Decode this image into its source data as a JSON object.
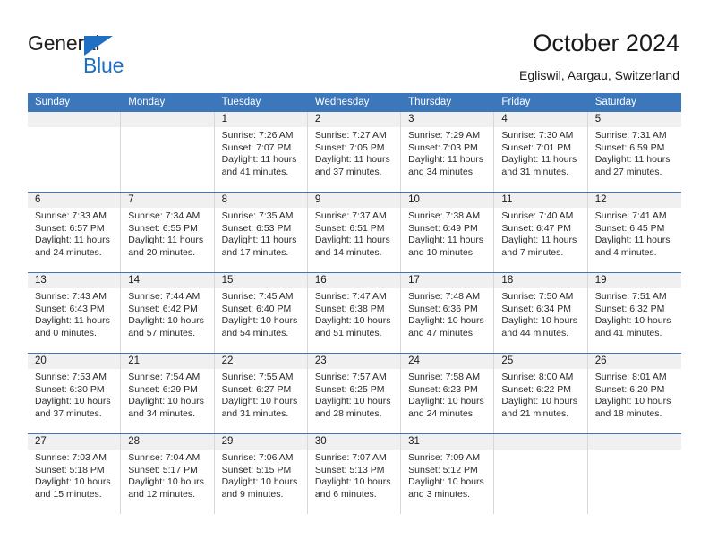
{
  "brand": {
    "name_top": "General",
    "name_bottom": "Blue",
    "flag_color": "#1f6fc4"
  },
  "header": {
    "title": "October 2024",
    "subtitle": "Egliswil, Aargau, Switzerland"
  },
  "theme": {
    "header_blue": "#3c77bc",
    "daynum_band": "#f0f0f0",
    "grid_line": "#d8d8d8"
  },
  "calendar": {
    "weekday_headers": [
      "Sunday",
      "Monday",
      "Tuesday",
      "Wednesday",
      "Thursday",
      "Friday",
      "Saturday"
    ],
    "weeks": [
      [
        {
          "day": "",
          "sunrise": "",
          "sunset": "",
          "daylight_line1": "",
          "daylight_line2": ""
        },
        {
          "day": "",
          "sunrise": "",
          "sunset": "",
          "daylight_line1": "",
          "daylight_line2": ""
        },
        {
          "day": "1",
          "sunrise": "Sunrise: 7:26 AM",
          "sunset": "Sunset: 7:07 PM",
          "daylight_line1": "Daylight: 11 hours",
          "daylight_line2": "and 41 minutes."
        },
        {
          "day": "2",
          "sunrise": "Sunrise: 7:27 AM",
          "sunset": "Sunset: 7:05 PM",
          "daylight_line1": "Daylight: 11 hours",
          "daylight_line2": "and 37 minutes."
        },
        {
          "day": "3",
          "sunrise": "Sunrise: 7:29 AM",
          "sunset": "Sunset: 7:03 PM",
          "daylight_line1": "Daylight: 11 hours",
          "daylight_line2": "and 34 minutes."
        },
        {
          "day": "4",
          "sunrise": "Sunrise: 7:30 AM",
          "sunset": "Sunset: 7:01 PM",
          "daylight_line1": "Daylight: 11 hours",
          "daylight_line2": "and 31 minutes."
        },
        {
          "day": "5",
          "sunrise": "Sunrise: 7:31 AM",
          "sunset": "Sunset: 6:59 PM",
          "daylight_line1": "Daylight: 11 hours",
          "daylight_line2": "and 27 minutes."
        }
      ],
      [
        {
          "day": "6",
          "sunrise": "Sunrise: 7:33 AM",
          "sunset": "Sunset: 6:57 PM",
          "daylight_line1": "Daylight: 11 hours",
          "daylight_line2": "and 24 minutes."
        },
        {
          "day": "7",
          "sunrise": "Sunrise: 7:34 AM",
          "sunset": "Sunset: 6:55 PM",
          "daylight_line1": "Daylight: 11 hours",
          "daylight_line2": "and 20 minutes."
        },
        {
          "day": "8",
          "sunrise": "Sunrise: 7:35 AM",
          "sunset": "Sunset: 6:53 PM",
          "daylight_line1": "Daylight: 11 hours",
          "daylight_line2": "and 17 minutes."
        },
        {
          "day": "9",
          "sunrise": "Sunrise: 7:37 AM",
          "sunset": "Sunset: 6:51 PM",
          "daylight_line1": "Daylight: 11 hours",
          "daylight_line2": "and 14 minutes."
        },
        {
          "day": "10",
          "sunrise": "Sunrise: 7:38 AM",
          "sunset": "Sunset: 6:49 PM",
          "daylight_line1": "Daylight: 11 hours",
          "daylight_line2": "and 10 minutes."
        },
        {
          "day": "11",
          "sunrise": "Sunrise: 7:40 AM",
          "sunset": "Sunset: 6:47 PM",
          "daylight_line1": "Daylight: 11 hours",
          "daylight_line2": "and 7 minutes."
        },
        {
          "day": "12",
          "sunrise": "Sunrise: 7:41 AM",
          "sunset": "Sunset: 6:45 PM",
          "daylight_line1": "Daylight: 11 hours",
          "daylight_line2": "and 4 minutes."
        }
      ],
      [
        {
          "day": "13",
          "sunrise": "Sunrise: 7:43 AM",
          "sunset": "Sunset: 6:43 PM",
          "daylight_line1": "Daylight: 11 hours",
          "daylight_line2": "and 0 minutes."
        },
        {
          "day": "14",
          "sunrise": "Sunrise: 7:44 AM",
          "sunset": "Sunset: 6:42 PM",
          "daylight_line1": "Daylight: 10 hours",
          "daylight_line2": "and 57 minutes."
        },
        {
          "day": "15",
          "sunrise": "Sunrise: 7:45 AM",
          "sunset": "Sunset: 6:40 PM",
          "daylight_line1": "Daylight: 10 hours",
          "daylight_line2": "and 54 minutes."
        },
        {
          "day": "16",
          "sunrise": "Sunrise: 7:47 AM",
          "sunset": "Sunset: 6:38 PM",
          "daylight_line1": "Daylight: 10 hours",
          "daylight_line2": "and 51 minutes."
        },
        {
          "day": "17",
          "sunrise": "Sunrise: 7:48 AM",
          "sunset": "Sunset: 6:36 PM",
          "daylight_line1": "Daylight: 10 hours",
          "daylight_line2": "and 47 minutes."
        },
        {
          "day": "18",
          "sunrise": "Sunrise: 7:50 AM",
          "sunset": "Sunset: 6:34 PM",
          "daylight_line1": "Daylight: 10 hours",
          "daylight_line2": "and 44 minutes."
        },
        {
          "day": "19",
          "sunrise": "Sunrise: 7:51 AM",
          "sunset": "Sunset: 6:32 PM",
          "daylight_line1": "Daylight: 10 hours",
          "daylight_line2": "and 41 minutes."
        }
      ],
      [
        {
          "day": "20",
          "sunrise": "Sunrise: 7:53 AM",
          "sunset": "Sunset: 6:30 PM",
          "daylight_line1": "Daylight: 10 hours",
          "daylight_line2": "and 37 minutes."
        },
        {
          "day": "21",
          "sunrise": "Sunrise: 7:54 AM",
          "sunset": "Sunset: 6:29 PM",
          "daylight_line1": "Daylight: 10 hours",
          "daylight_line2": "and 34 minutes."
        },
        {
          "day": "22",
          "sunrise": "Sunrise: 7:55 AM",
          "sunset": "Sunset: 6:27 PM",
          "daylight_line1": "Daylight: 10 hours",
          "daylight_line2": "and 31 minutes."
        },
        {
          "day": "23",
          "sunrise": "Sunrise: 7:57 AM",
          "sunset": "Sunset: 6:25 PM",
          "daylight_line1": "Daylight: 10 hours",
          "daylight_line2": "and 28 minutes."
        },
        {
          "day": "24",
          "sunrise": "Sunrise: 7:58 AM",
          "sunset": "Sunset: 6:23 PM",
          "daylight_line1": "Daylight: 10 hours",
          "daylight_line2": "and 24 minutes."
        },
        {
          "day": "25",
          "sunrise": "Sunrise: 8:00 AM",
          "sunset": "Sunset: 6:22 PM",
          "daylight_line1": "Daylight: 10 hours",
          "daylight_line2": "and 21 minutes."
        },
        {
          "day": "26",
          "sunrise": "Sunrise: 8:01 AM",
          "sunset": "Sunset: 6:20 PM",
          "daylight_line1": "Daylight: 10 hours",
          "daylight_line2": "and 18 minutes."
        }
      ],
      [
        {
          "day": "27",
          "sunrise": "Sunrise: 7:03 AM",
          "sunset": "Sunset: 5:18 PM",
          "daylight_line1": "Daylight: 10 hours",
          "daylight_line2": "and 15 minutes."
        },
        {
          "day": "28",
          "sunrise": "Sunrise: 7:04 AM",
          "sunset": "Sunset: 5:17 PM",
          "daylight_line1": "Daylight: 10 hours",
          "daylight_line2": "and 12 minutes."
        },
        {
          "day": "29",
          "sunrise": "Sunrise: 7:06 AM",
          "sunset": "Sunset: 5:15 PM",
          "daylight_line1": "Daylight: 10 hours",
          "daylight_line2": "and 9 minutes."
        },
        {
          "day": "30",
          "sunrise": "Sunrise: 7:07 AM",
          "sunset": "Sunset: 5:13 PM",
          "daylight_line1": "Daylight: 10 hours",
          "daylight_line2": "and 6 minutes."
        },
        {
          "day": "31",
          "sunrise": "Sunrise: 7:09 AM",
          "sunset": "Sunset: 5:12 PM",
          "daylight_line1": "Daylight: 10 hours",
          "daylight_line2": "and 3 minutes."
        },
        {
          "day": "",
          "sunrise": "",
          "sunset": "",
          "daylight_line1": "",
          "daylight_line2": ""
        },
        {
          "day": "",
          "sunrise": "",
          "sunset": "",
          "daylight_line1": "",
          "daylight_line2": ""
        }
      ]
    ]
  }
}
